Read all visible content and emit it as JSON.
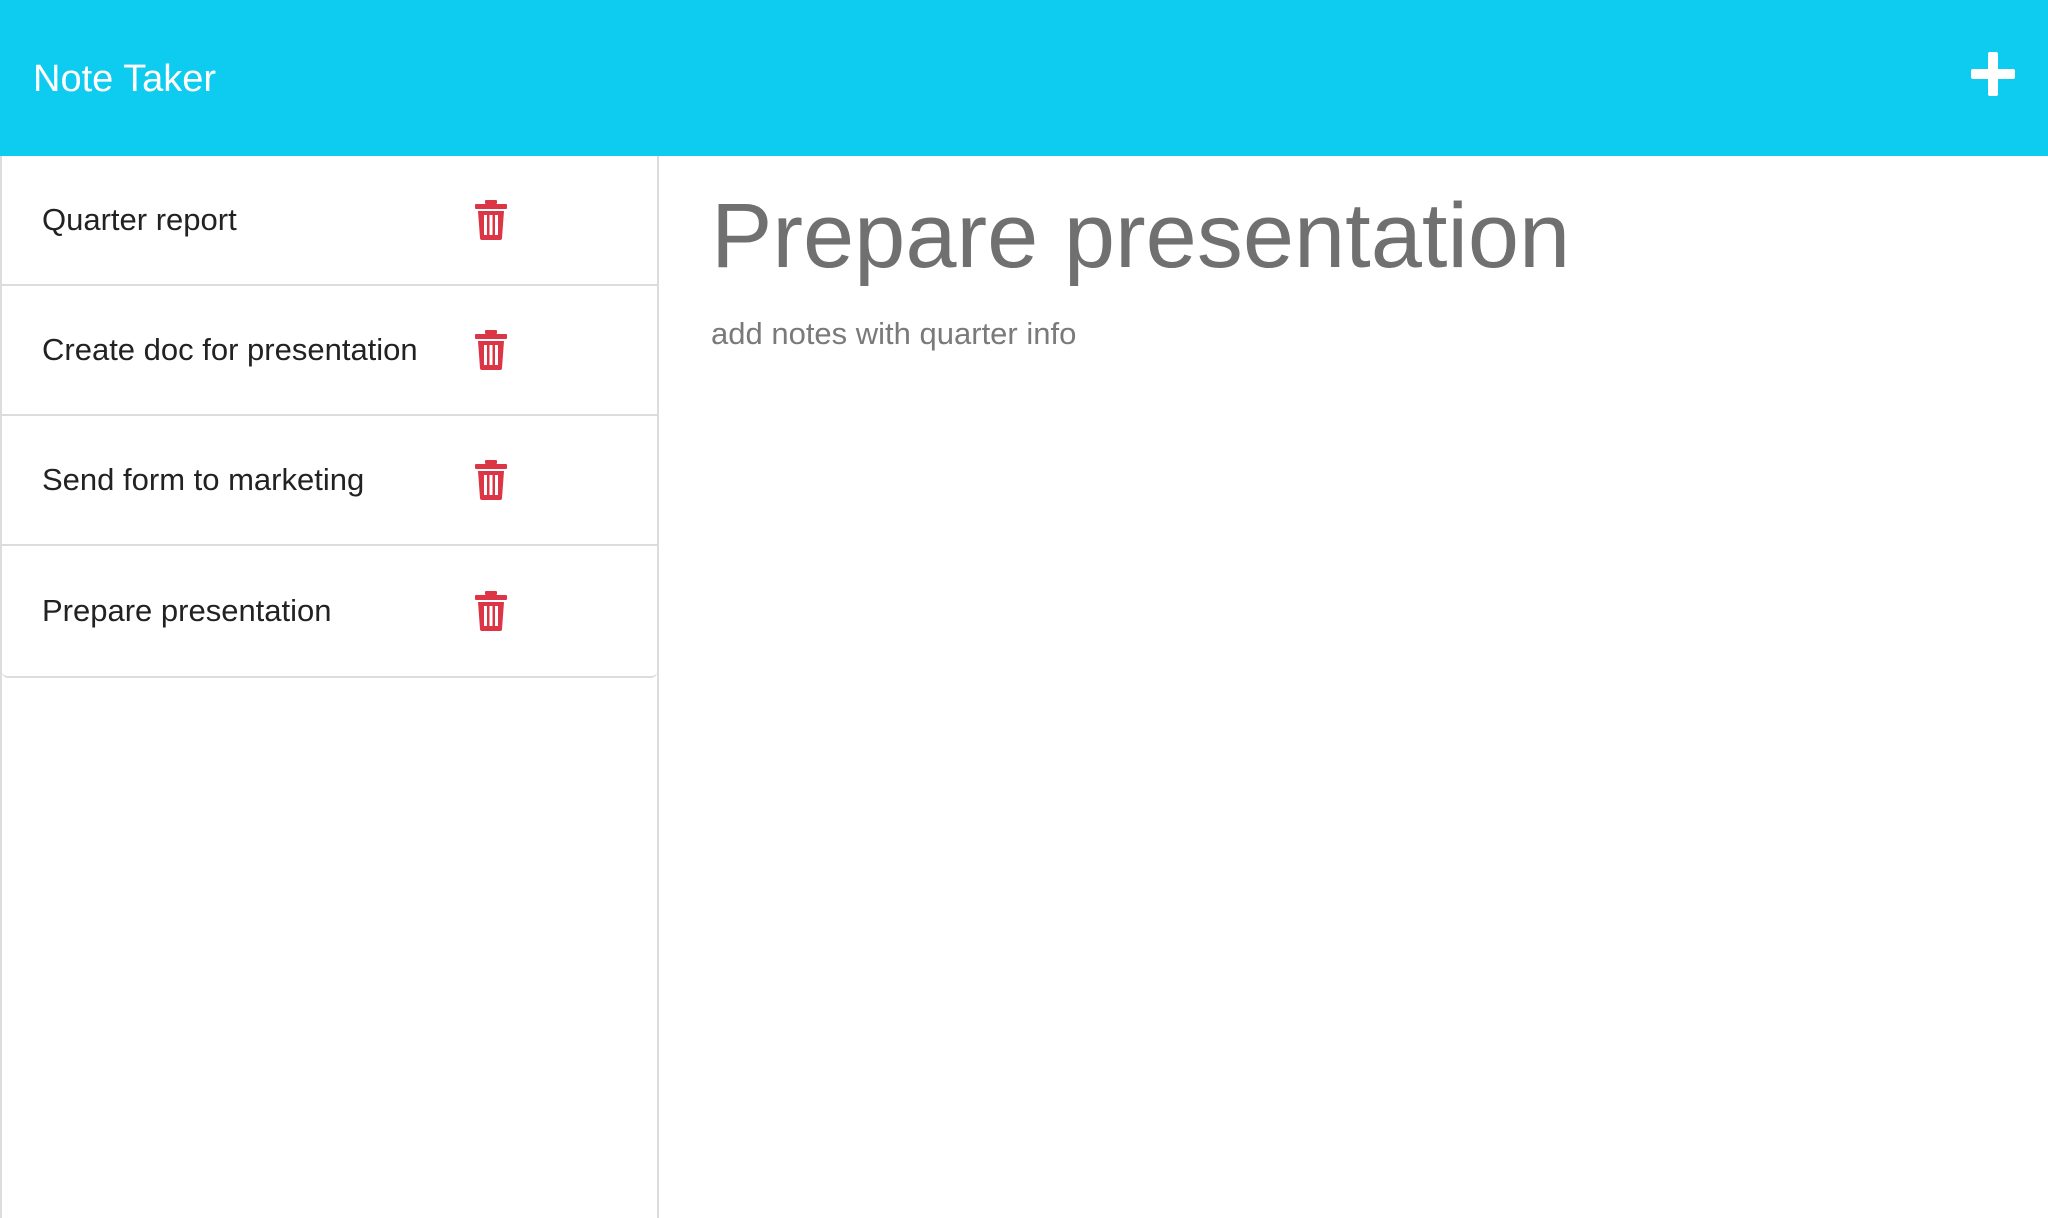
{
  "navbar": {
    "brand": "Note Taker",
    "add_icon": "plus-icon",
    "color": "#0ecbf0"
  },
  "sidebar": {
    "notes": [
      {
        "title": "Quarter report",
        "delete_icon": "trash-icon"
      },
      {
        "title": "Create doc for presentation",
        "delete_icon": "trash-icon"
      },
      {
        "title": "Send form to marketing",
        "delete_icon": "trash-icon"
      },
      {
        "title": "Prepare presentation",
        "delete_icon": "trash-icon"
      }
    ],
    "delete_color": "#dc3545"
  },
  "main": {
    "note_title": "Prepare presentation",
    "note_text": "add notes with quarter info"
  }
}
